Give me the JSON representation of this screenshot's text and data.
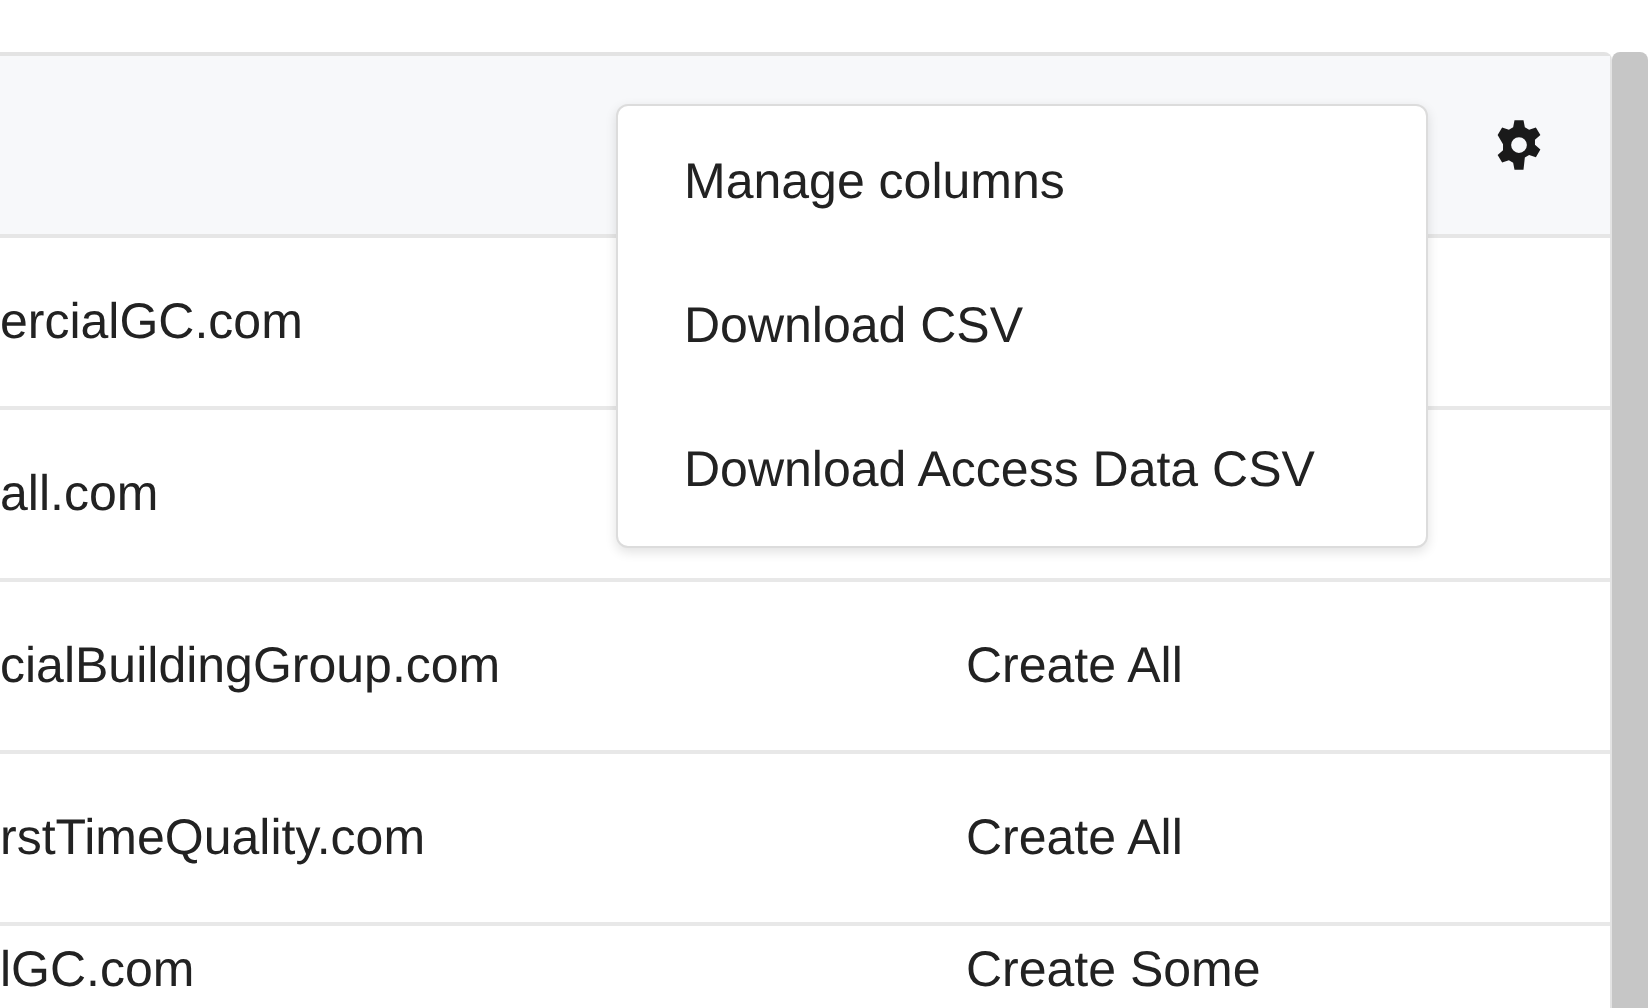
{
  "settings_menu": {
    "items": [
      {
        "label": "Manage columns"
      },
      {
        "label": "Download CSV"
      },
      {
        "label": "Download Access Data CSV"
      }
    ]
  },
  "table": {
    "rows": [
      {
        "column_1": "ercialGC.com"
      },
      {
        "column_1": "all.com"
      },
      {
        "column_1": "cialBuildingGroup.com",
        "column_2": "Create All"
      },
      {
        "column_1": "rstTimeQuality.com",
        "column_2": "Create All"
      },
      {
        "column_1": "lGC.com",
        "column_2": "Create Some"
      }
    ]
  }
}
